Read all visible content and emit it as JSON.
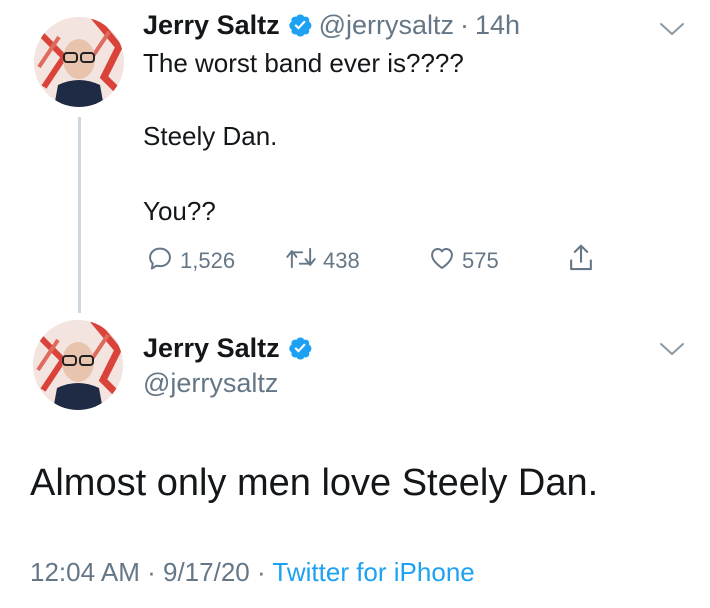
{
  "tweet1": {
    "author_name": "Jerry Saltz",
    "handle": "@jerrysaltz",
    "separator": "·",
    "time_ago": "14h",
    "text_lines": [
      "The worst band ever is????",
      "Steely Dan.",
      "You??"
    ],
    "actions": {
      "reply_count": "1,526",
      "retweet_count": "438",
      "like_count": "575"
    }
  },
  "tweet2": {
    "author_name": "Jerry Saltz",
    "handle": "@jerrysaltz",
    "text": "Almost only men love Steely Dan.",
    "meta": {
      "time": "12:04 AM",
      "sep1": "·",
      "date": "9/17/20",
      "sep2": "·",
      "source": "Twitter for iPhone"
    }
  },
  "icons": [
    "verified-badge-icon",
    "chevron-down-icon",
    "reply-icon",
    "retweet-icon",
    "like-icon",
    "share-icon"
  ],
  "colors": {
    "text": "#14171a",
    "secondary": "#657786",
    "link": "#1da1f2",
    "verified": "#1da1f2",
    "thread_line": "#cfd7de"
  }
}
